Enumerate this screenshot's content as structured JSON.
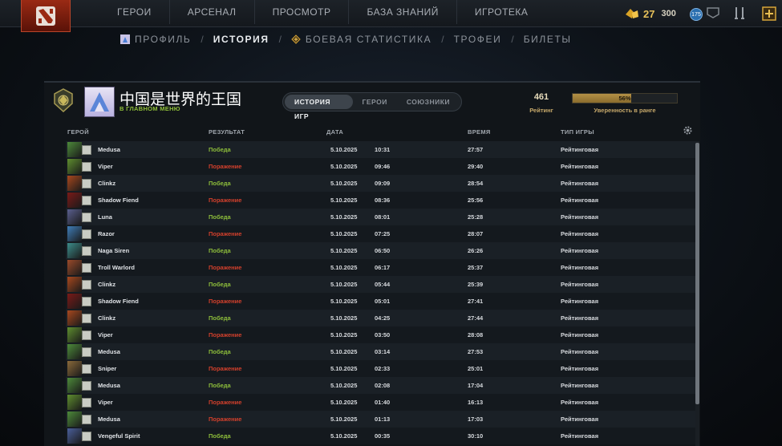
{
  "nav": {
    "items": [
      {
        "label": "ГЕРОИ"
      },
      {
        "label": "АРСЕНАЛ"
      },
      {
        "label": "ПРОСМОТР"
      },
      {
        "label": "БАЗА ЗНАНИЙ"
      },
      {
        "label": "ИГРОТЕКА"
      }
    ],
    "shards": "27",
    "gold": "300",
    "level": "175"
  },
  "subnav": {
    "profile": "ПРОФИЛЬ",
    "history": "ИСТОРИЯ",
    "stats": "БОЕВАЯ СТАТИСТИКА",
    "trophies": "ТРОФЕИ",
    "tickets": "БИЛЕТЫ",
    "separator": "/"
  },
  "player": {
    "name": "中国是世界的王国",
    "status": "В ГЛАВНОМ МЕНЮ"
  },
  "tabs": [
    "ИСТОРИЯ ИГР",
    "ГЕРОИ",
    "СОЮЗНИКИ"
  ],
  "rating": {
    "value": "461",
    "label": "Рейтинг",
    "confidence": 56,
    "confidence_text": "56%",
    "confidence_label": "Уверенность в ранге"
  },
  "table": {
    "headers": {
      "hero": "ГЕРОЙ",
      "result": "РЕЗУЛЬТАТ",
      "date": "ДАТА",
      "duration": "ВРЕМЯ",
      "mode": "ТИП ИГРЫ"
    },
    "rows": [
      {
        "hero": "Medusa",
        "result": "Победа",
        "win": true,
        "date": "5.10.2025",
        "time": "10:31",
        "duration": "27:57",
        "mode": "Рейтинговая",
        "color": "#4d8a3a"
      },
      {
        "hero": "Viper",
        "result": "Поражение",
        "win": false,
        "date": "5.10.2025",
        "time": "09:46",
        "duration": "29:40",
        "mode": "Рейтинговая",
        "color": "#5f8e2f"
      },
      {
        "hero": "Clinkz",
        "result": "Победа",
        "win": true,
        "date": "5.10.2025",
        "time": "09:09",
        "duration": "28:54",
        "mode": "Рейтинговая",
        "color": "#a8481e"
      },
      {
        "hero": "Shadow Fiend",
        "result": "Поражение",
        "win": false,
        "date": "5.10.2025",
        "time": "08:36",
        "duration": "25:56",
        "mode": "Рейтинговая",
        "color": "#7a1a18"
      },
      {
        "hero": "Luna",
        "result": "Победа",
        "win": true,
        "date": "5.10.2025",
        "time": "08:01",
        "duration": "25:28",
        "mode": "Рейтинговая",
        "color": "#5a5f8e"
      },
      {
        "hero": "Razor",
        "result": "Поражение",
        "win": false,
        "date": "5.10.2025",
        "time": "07:25",
        "duration": "28:07",
        "mode": "Рейтинговая",
        "color": "#3f7db8"
      },
      {
        "hero": "Naga Siren",
        "result": "Победа",
        "win": true,
        "date": "5.10.2025",
        "time": "06:50",
        "duration": "26:26",
        "mode": "Рейтинговая",
        "color": "#3c8c8a"
      },
      {
        "hero": "Troll Warlord",
        "result": "Поражение",
        "win": false,
        "date": "5.10.2025",
        "time": "06:17",
        "duration": "25:37",
        "mode": "Рейтинговая",
        "color": "#9a4a2a"
      },
      {
        "hero": "Clinkz",
        "result": "Победа",
        "win": true,
        "date": "5.10.2025",
        "time": "05:44",
        "duration": "25:39",
        "mode": "Рейтинговая",
        "color": "#a8481e"
      },
      {
        "hero": "Shadow Fiend",
        "result": "Поражение",
        "win": false,
        "date": "5.10.2025",
        "time": "05:01",
        "duration": "27:41",
        "mode": "Рейтинговая",
        "color": "#7a1a18"
      },
      {
        "hero": "Clinkz",
        "result": "Победа",
        "win": true,
        "date": "5.10.2025",
        "time": "04:25",
        "duration": "27:44",
        "mode": "Рейтинговая",
        "color": "#a8481e"
      },
      {
        "hero": "Viper",
        "result": "Поражение",
        "win": false,
        "date": "5.10.2025",
        "time": "03:50",
        "duration": "28:08",
        "mode": "Рейтинговая",
        "color": "#5f8e2f"
      },
      {
        "hero": "Medusa",
        "result": "Победа",
        "win": true,
        "date": "5.10.2025",
        "time": "03:14",
        "duration": "27:53",
        "mode": "Рейтинговая",
        "color": "#4d8a3a"
      },
      {
        "hero": "Sniper",
        "result": "Поражение",
        "win": false,
        "date": "5.10.2025",
        "time": "02:33",
        "duration": "25:01",
        "mode": "Рейтинговая",
        "color": "#8a6a3a"
      },
      {
        "hero": "Medusa",
        "result": "Победа",
        "win": true,
        "date": "5.10.2025",
        "time": "02:08",
        "duration": "17:04",
        "mode": "Рейтинговая",
        "color": "#4d8a3a"
      },
      {
        "hero": "Viper",
        "result": "Поражение",
        "win": false,
        "date": "5.10.2025",
        "time": "01:40",
        "duration": "16:13",
        "mode": "Рейтинговая",
        "color": "#5f8e2f"
      },
      {
        "hero": "Medusa",
        "result": "Поражение",
        "win": false,
        "date": "5.10.2025",
        "time": "01:13",
        "duration": "17:03",
        "mode": "Рейтинговая",
        "color": "#4d8a3a"
      },
      {
        "hero": "Vengeful Spirit",
        "result": "Победа",
        "win": true,
        "date": "5.10.2025",
        "time": "00:35",
        "duration": "30:10",
        "mode": "Рейтинговая",
        "color": "#4a5f9a"
      }
    ]
  }
}
